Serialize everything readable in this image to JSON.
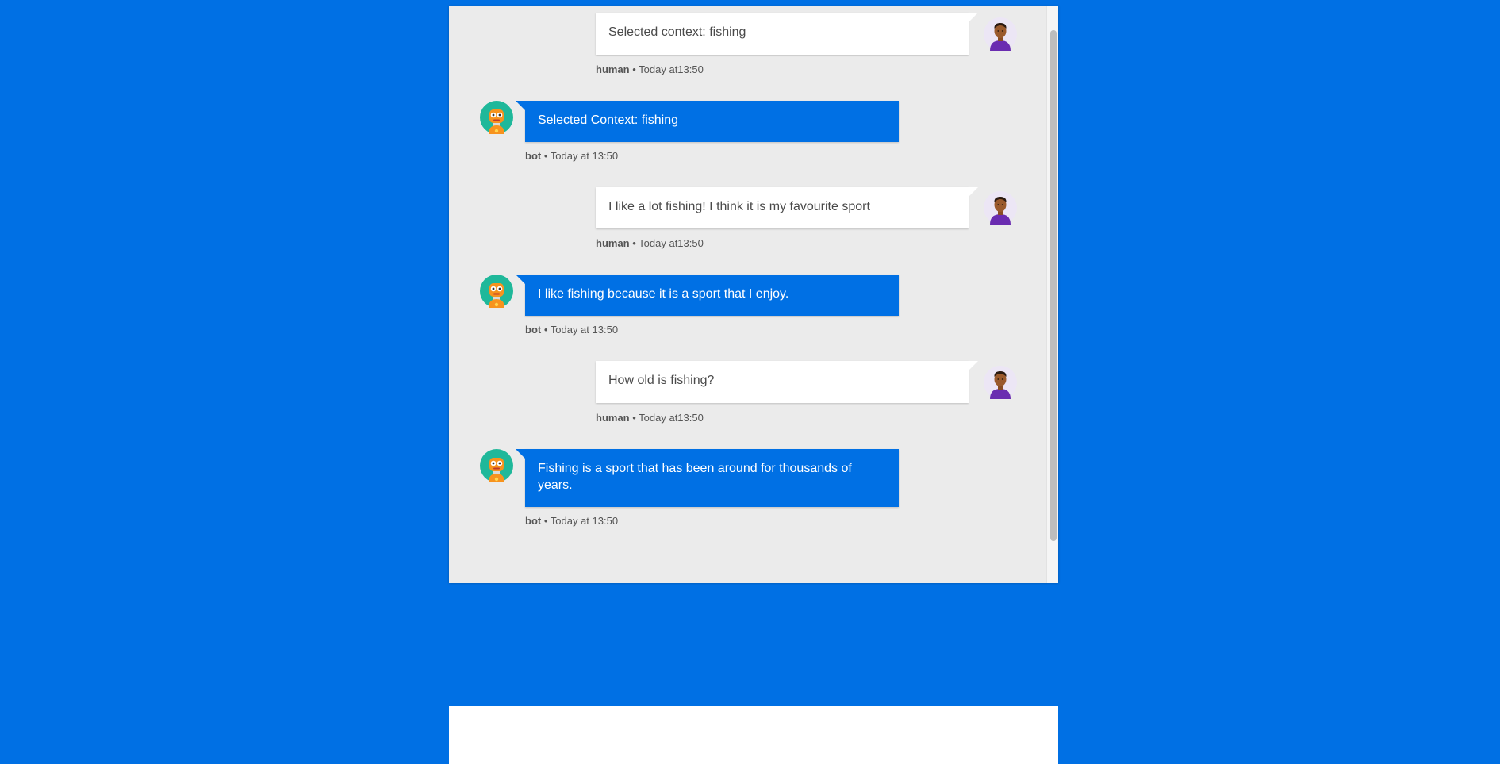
{
  "messages": [
    {
      "sender": "human",
      "text": "Selected context: fishing",
      "meta_name": "human",
      "meta_time": " • Today at13:50"
    },
    {
      "sender": "bot",
      "text": "Selected Context: fishing",
      "meta_name": "bot",
      "meta_time": " • Today at 13:50"
    },
    {
      "sender": "human",
      "text": "I like a lot fishing! I think it is my favourite sport",
      "meta_name": "human",
      "meta_time": " • Today at13:50"
    },
    {
      "sender": "bot",
      "text": "I like fishing because it is a sport that I enjoy.",
      "meta_name": "bot",
      "meta_time": " • Today at 13:50"
    },
    {
      "sender": "human",
      "text": "How old is fishing?",
      "meta_name": "human",
      "meta_time": " • Today at13:50"
    },
    {
      "sender": "bot",
      "text": "Fishing is a sport that has been around for thousands of years.",
      "meta_name": "bot",
      "meta_time": " • Today at 13:50"
    }
  ],
  "avatars": {
    "human_icon": "human-avatar-icon",
    "bot_icon": "robot-avatar-icon"
  },
  "colors": {
    "background": "#0070e4",
    "bot_bubble": "#0070e4",
    "human_bubble": "#ffffff",
    "chat_area": "#ebebeb"
  }
}
